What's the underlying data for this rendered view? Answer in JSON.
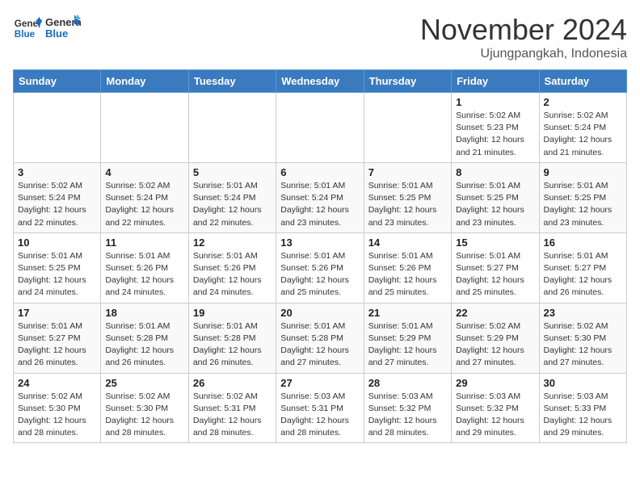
{
  "header": {
    "logo_line1": "General",
    "logo_line2": "Blue",
    "month": "November 2024",
    "location": "Ujungpangkah, Indonesia"
  },
  "days_of_week": [
    "Sunday",
    "Monday",
    "Tuesday",
    "Wednesday",
    "Thursday",
    "Friday",
    "Saturday"
  ],
  "weeks": [
    [
      {
        "day": "",
        "empty": true
      },
      {
        "day": "",
        "empty": true
      },
      {
        "day": "",
        "empty": true
      },
      {
        "day": "",
        "empty": true
      },
      {
        "day": "",
        "empty": true
      },
      {
        "day": "1",
        "sunrise": "5:02 AM",
        "sunset": "5:23 PM",
        "daylight": "12 hours and 21 minutes."
      },
      {
        "day": "2",
        "sunrise": "5:02 AM",
        "sunset": "5:24 PM",
        "daylight": "12 hours and 21 minutes."
      }
    ],
    [
      {
        "day": "3",
        "sunrise": "5:02 AM",
        "sunset": "5:24 PM",
        "daylight": "12 hours and 22 minutes."
      },
      {
        "day": "4",
        "sunrise": "5:02 AM",
        "sunset": "5:24 PM",
        "daylight": "12 hours and 22 minutes."
      },
      {
        "day": "5",
        "sunrise": "5:01 AM",
        "sunset": "5:24 PM",
        "daylight": "12 hours and 22 minutes."
      },
      {
        "day": "6",
        "sunrise": "5:01 AM",
        "sunset": "5:24 PM",
        "daylight": "12 hours and 23 minutes."
      },
      {
        "day": "7",
        "sunrise": "5:01 AM",
        "sunset": "5:25 PM",
        "daylight": "12 hours and 23 minutes."
      },
      {
        "day": "8",
        "sunrise": "5:01 AM",
        "sunset": "5:25 PM",
        "daylight": "12 hours and 23 minutes."
      },
      {
        "day": "9",
        "sunrise": "5:01 AM",
        "sunset": "5:25 PM",
        "daylight": "12 hours and 23 minutes."
      }
    ],
    [
      {
        "day": "10",
        "sunrise": "5:01 AM",
        "sunset": "5:25 PM",
        "daylight": "12 hours and 24 minutes."
      },
      {
        "day": "11",
        "sunrise": "5:01 AM",
        "sunset": "5:26 PM",
        "daylight": "12 hours and 24 minutes."
      },
      {
        "day": "12",
        "sunrise": "5:01 AM",
        "sunset": "5:26 PM",
        "daylight": "12 hours and 24 minutes."
      },
      {
        "day": "13",
        "sunrise": "5:01 AM",
        "sunset": "5:26 PM",
        "daylight": "12 hours and 25 minutes."
      },
      {
        "day": "14",
        "sunrise": "5:01 AM",
        "sunset": "5:26 PM",
        "daylight": "12 hours and 25 minutes."
      },
      {
        "day": "15",
        "sunrise": "5:01 AM",
        "sunset": "5:27 PM",
        "daylight": "12 hours and 25 minutes."
      },
      {
        "day": "16",
        "sunrise": "5:01 AM",
        "sunset": "5:27 PM",
        "daylight": "12 hours and 26 minutes."
      }
    ],
    [
      {
        "day": "17",
        "sunrise": "5:01 AM",
        "sunset": "5:27 PM",
        "daylight": "12 hours and 26 minutes."
      },
      {
        "day": "18",
        "sunrise": "5:01 AM",
        "sunset": "5:28 PM",
        "daylight": "12 hours and 26 minutes."
      },
      {
        "day": "19",
        "sunrise": "5:01 AM",
        "sunset": "5:28 PM",
        "daylight": "12 hours and 26 minutes."
      },
      {
        "day": "20",
        "sunrise": "5:01 AM",
        "sunset": "5:28 PM",
        "daylight": "12 hours and 27 minutes."
      },
      {
        "day": "21",
        "sunrise": "5:01 AM",
        "sunset": "5:29 PM",
        "daylight": "12 hours and 27 minutes."
      },
      {
        "day": "22",
        "sunrise": "5:02 AM",
        "sunset": "5:29 PM",
        "daylight": "12 hours and 27 minutes."
      },
      {
        "day": "23",
        "sunrise": "5:02 AM",
        "sunset": "5:30 PM",
        "daylight": "12 hours and 27 minutes."
      }
    ],
    [
      {
        "day": "24",
        "sunrise": "5:02 AM",
        "sunset": "5:30 PM",
        "daylight": "12 hours and 28 minutes."
      },
      {
        "day": "25",
        "sunrise": "5:02 AM",
        "sunset": "5:30 PM",
        "daylight": "12 hours and 28 minutes."
      },
      {
        "day": "26",
        "sunrise": "5:02 AM",
        "sunset": "5:31 PM",
        "daylight": "12 hours and 28 minutes."
      },
      {
        "day": "27",
        "sunrise": "5:03 AM",
        "sunset": "5:31 PM",
        "daylight": "12 hours and 28 minutes."
      },
      {
        "day": "28",
        "sunrise": "5:03 AM",
        "sunset": "5:32 PM",
        "daylight": "12 hours and 28 minutes."
      },
      {
        "day": "29",
        "sunrise": "5:03 AM",
        "sunset": "5:32 PM",
        "daylight": "12 hours and 29 minutes."
      },
      {
        "day": "30",
        "sunrise": "5:03 AM",
        "sunset": "5:33 PM",
        "daylight": "12 hours and 29 minutes."
      }
    ]
  ]
}
